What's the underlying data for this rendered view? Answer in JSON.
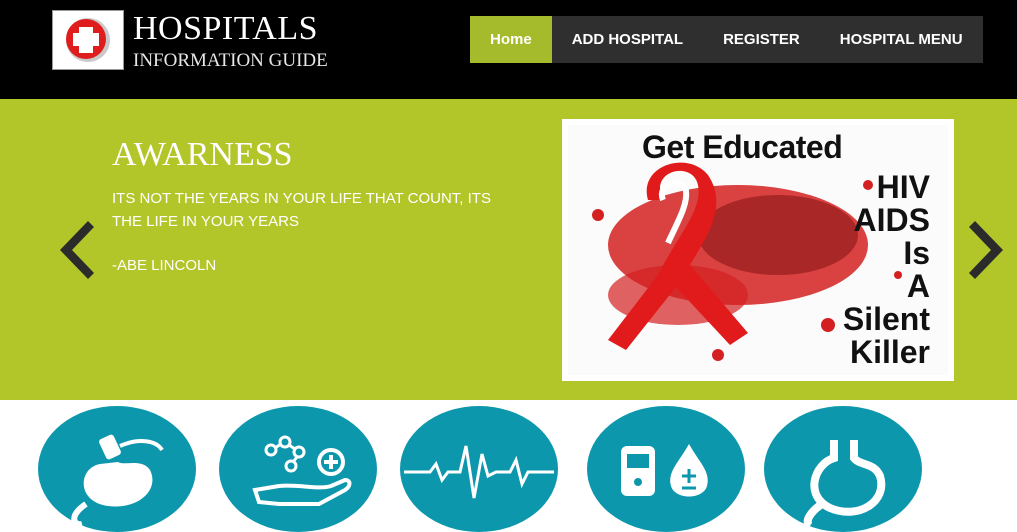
{
  "header": {
    "title": "HOSPITALS",
    "subtitle": "INFORMATION GUIDE",
    "logo_icon": "red-cross-icon"
  },
  "nav": {
    "items": [
      {
        "label": "Home",
        "active": true
      },
      {
        "label": "ADD HOSPITAL",
        "active": false
      },
      {
        "label": "REGISTER",
        "active": false
      },
      {
        "label": "HOSPITAL MENU",
        "active": false
      }
    ]
  },
  "hero": {
    "heading": "AWARNESS",
    "quote": "ITS NOT THE YEARS IN YOUR LIFE THAT COUNT, ITS THE LIFE IN YOUR YEARS",
    "author": "-ABE LINCOLN",
    "prev_icon": "chevron-left-icon",
    "next_icon": "chevron-right-icon",
    "image": {
      "headline": "Get Educated",
      "lines": [
        "HIV",
        "AIDS",
        "Is",
        "A",
        "Silent",
        "Killer"
      ]
    }
  },
  "features": [
    {
      "icon": "stomach-ultrasound-icon"
    },
    {
      "icon": "molecule-hand-plus-icon"
    },
    {
      "icon": "heartbeat-icon"
    },
    {
      "icon": "glucose-meter-drop-icon"
    },
    {
      "icon": "stomach-icon"
    }
  ],
  "colors": {
    "header_bg": "#000000",
    "nav_bg": "#2f2f2f",
    "accent_green": "#b2c62a",
    "nav_active": "#a6bb2b",
    "icon_teal": "#0d97ad",
    "ribbon_red": "#e11b1b"
  }
}
